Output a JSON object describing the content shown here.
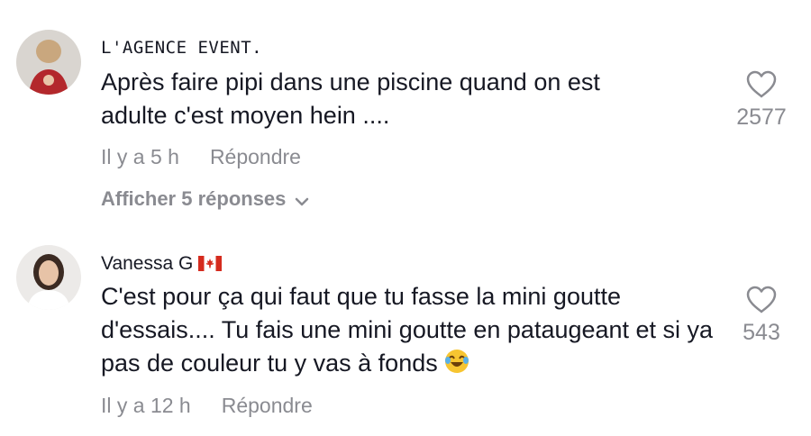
{
  "comments": [
    {
      "username": "L'AGENCE EVENT.",
      "text": "Après faire pipi dans une piscine quand on est adulte c'est moyen hein ....",
      "time": "Il y a 5 h",
      "reply_label": "Répondre",
      "likes": "2577",
      "view_replies": "Afficher 5 réponses"
    },
    {
      "username": "Vanessa G",
      "username_flag": "canada-flag-icon",
      "text": "C'est pour ça qui faut que tu fasse la mini goutte d'essais.... Tu fais une mini goutte en pataugeant et si ya pas de couleur tu y vas à fonds",
      "text_emoji": "laughing-tears-emoji-icon",
      "time": "Il y a 12 h",
      "reply_label": "Répondre",
      "likes": "543"
    }
  ],
  "colors": {
    "text": "#161823",
    "secondary": "#8a8b91"
  }
}
